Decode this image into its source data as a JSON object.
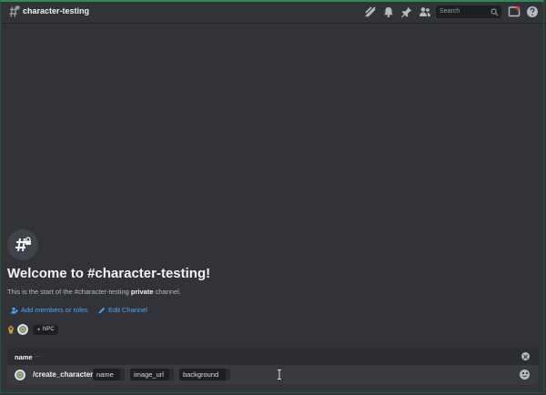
{
  "header": {
    "channel_name": "character-testing",
    "search_placeholder": "Search",
    "icons": [
      "threads-icon",
      "bell-icon",
      "pin-icon",
      "members-icon",
      "search-icon",
      "inbox-icon",
      "help-icon"
    ]
  },
  "welcome": {
    "title": "Welcome to #character-testing!",
    "subtitle_prefix": "This is the start of the #character-testing ",
    "subtitle_bold": "private",
    "subtitle_suffix": " channel.",
    "add_members_label": "Add members or roles",
    "edit_channel_label": "Edit Channel"
  },
  "members": {
    "npc_tag": "NPC"
  },
  "option_popup": {
    "label": "name",
    "ellipsis": "..."
  },
  "composer": {
    "command": "/create_character",
    "options": [
      "name",
      "image_url",
      "background"
    ]
  },
  "colors": {
    "background": "#313338",
    "link": "#4ea4f5",
    "composer": "#383a40"
  }
}
